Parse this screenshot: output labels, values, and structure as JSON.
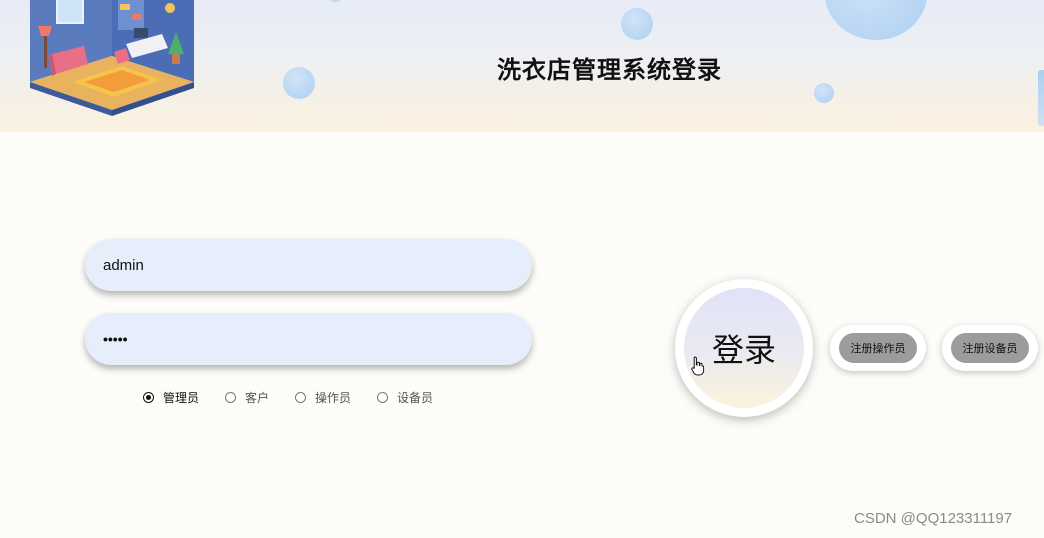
{
  "header": {
    "title": "洗衣店管理系统登录"
  },
  "form": {
    "username_value": "admin",
    "password_value": "•••••"
  },
  "roles": {
    "items": [
      {
        "label": "管理员",
        "checked": true
      },
      {
        "label": "客户",
        "checked": false
      },
      {
        "label": "操作员",
        "checked": false
      },
      {
        "label": "设备员",
        "checked": false
      }
    ]
  },
  "buttons": {
    "login_label": "登录",
    "register_operator_label": "注册操作员",
    "register_device_label": "注册设备员"
  },
  "watermark": {
    "text": "CSDN @QQ123311197"
  },
  "colors": {
    "input_background": "#e6eefb",
    "small_button_background": "#9c9c9c",
    "bubble_blue": "#b5d4f3"
  },
  "icons": {
    "cursor": "hand-pointer-icon",
    "illustration": "room-illustration"
  }
}
